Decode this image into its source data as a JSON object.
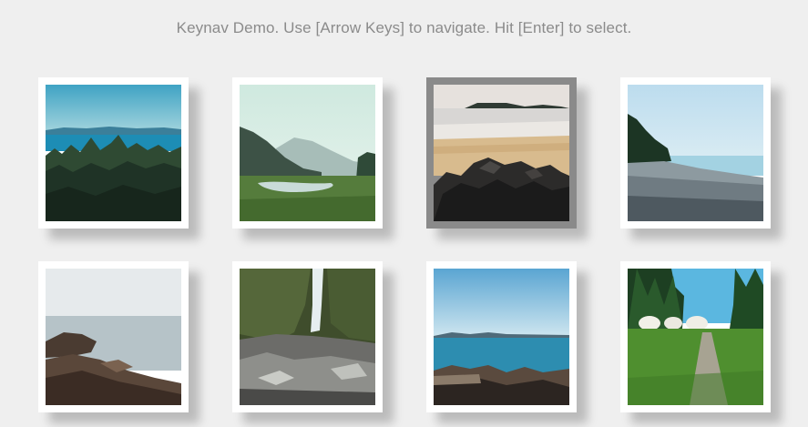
{
  "header": {
    "title": "Keynav Demo. Use [Arrow Keys] to navigate. Hit [Enter] to select."
  },
  "gallery": {
    "selected_index": 2,
    "tiles": [
      {
        "name": "forest-sea-photo"
      },
      {
        "name": "river-valley-photo"
      },
      {
        "name": "rocky-beach-photo"
      },
      {
        "name": "pebble-shore-photo"
      },
      {
        "name": "coastal-rocks-photo"
      },
      {
        "name": "waterfall-photo"
      },
      {
        "name": "ocean-shore-photo"
      },
      {
        "name": "forest-path-photo"
      }
    ]
  },
  "colors": {
    "background": "#efefef",
    "header_text": "#8b8b8b",
    "tile_frame": "#ffffff",
    "selected_frame": "#8a8a8a"
  }
}
